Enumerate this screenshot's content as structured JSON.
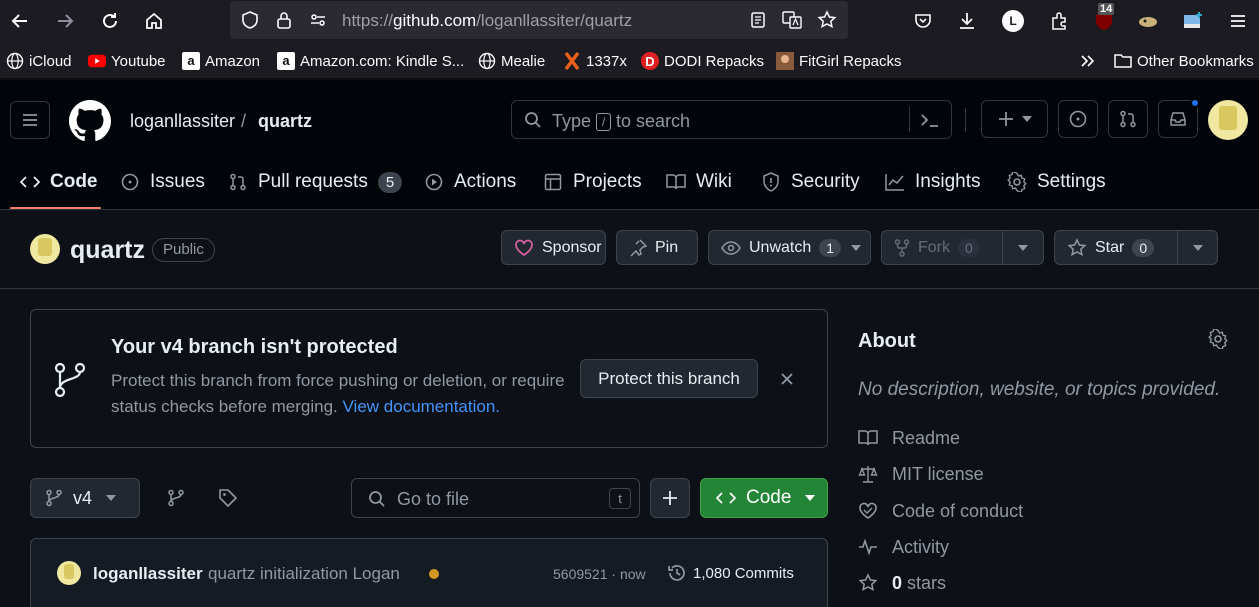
{
  "browser": {
    "url_prefix": "https://",
    "url_host": "github.com",
    "url_path": "/loganllassiter/quartz",
    "profile_initial": "L",
    "badge_count": "14",
    "bookmarks": [
      {
        "label": "iCloud",
        "icon": "globe-icon"
      },
      {
        "label": "Youtube",
        "icon": "youtube-icon"
      },
      {
        "label": "Amazon",
        "icon": "amazon-icon"
      },
      {
        "label": "Amazon.com: Kindle S...",
        "icon": "amazon-icon"
      },
      {
        "label": "Mealie",
        "icon": "globe-icon"
      },
      {
        "label": "1337x",
        "icon": "x-icon"
      },
      {
        "label": "DODI Repacks",
        "icon": "dodi-icon"
      },
      {
        "label": "FitGirl Repacks",
        "icon": "fitgirl-icon"
      }
    ],
    "other_bookmarks": "Other Bookmarks"
  },
  "header": {
    "owner": "loganllassiter",
    "separator": "/",
    "repo": "quartz",
    "search_prefix": "Type",
    "search_key": "/",
    "search_suffix": "to search"
  },
  "tabs": [
    {
      "label": "Code",
      "icon": "code-icon"
    },
    {
      "label": "Issues",
      "icon": "issue-icon"
    },
    {
      "label": "Pull requests",
      "icon": "pull-request-icon",
      "count": "5"
    },
    {
      "label": "Actions",
      "icon": "play-icon"
    },
    {
      "label": "Projects",
      "icon": "table-icon"
    },
    {
      "label": "Wiki",
      "icon": "book-icon"
    },
    {
      "label": "Security",
      "icon": "shield-icon"
    },
    {
      "label": "Insights",
      "icon": "graph-icon"
    },
    {
      "label": "Settings",
      "icon": "gear-icon"
    }
  ],
  "repo": {
    "name": "quartz",
    "visibility": "Public",
    "sponsor": "Sponsor",
    "pin": "Pin",
    "watch": "Unwatch",
    "watch_count": "1",
    "fork": "Fork",
    "fork_count": "0",
    "star": "Star",
    "star_count": "0"
  },
  "banner": {
    "title": "Your v4 branch isn't protected",
    "description": "Protect this branch from force pushing or deletion, or require status checks before merging.",
    "link": "View documentation.",
    "button": "Protect this branch"
  },
  "file_nav": {
    "branch": "v4",
    "goto_placeholder": "Go to file",
    "goto_key": "t",
    "code_button": "Code"
  },
  "commit": {
    "author": "loganllassiter",
    "message": "quartz initialization Logan",
    "sha_time": "5609521 · now",
    "commits": "1,080 Commits"
  },
  "about": {
    "title": "About",
    "description": "No description, website, or topics provided.",
    "items": [
      {
        "label": "Readme",
        "icon": "book-icon"
      },
      {
        "label": "MIT license",
        "icon": "law-icon"
      },
      {
        "label": "Code of conduct",
        "icon": "heart-icon"
      },
      {
        "label": "Activity",
        "icon": "pulse-icon"
      }
    ],
    "stars_count": "0",
    "stars_label": "stars"
  },
  "colors": {
    "accent_underline": "#f78166",
    "code_button": "#238636",
    "link": "#4493f8",
    "status_dot": "#d29922"
  }
}
